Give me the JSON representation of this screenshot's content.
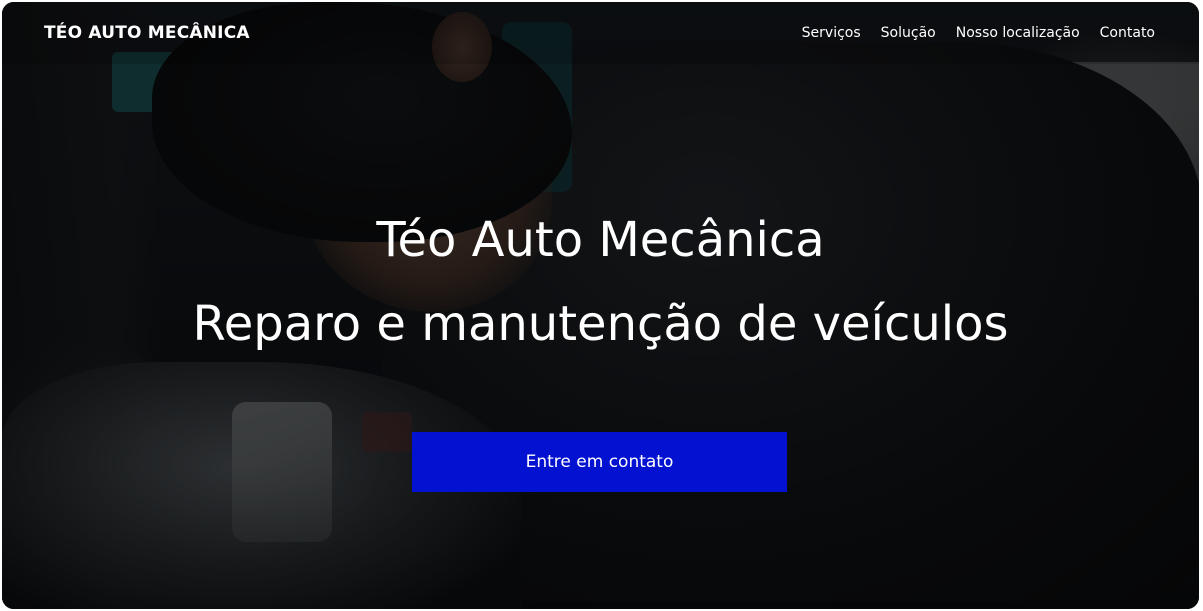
{
  "navbar": {
    "brand": "TÉO AUTO MECÂNICA",
    "links": [
      {
        "label": "Serviços"
      },
      {
        "label": "Solução"
      },
      {
        "label": "Nosso localização"
      },
      {
        "label": "Contato"
      }
    ]
  },
  "hero": {
    "title": "Téo Auto Mecânica",
    "subtitle": "Reparo e manutenção de veículos",
    "cta_label": "Entre em contato",
    "image_description_icon": "mechanic-photo",
    "cta_color": "#0312d0"
  }
}
